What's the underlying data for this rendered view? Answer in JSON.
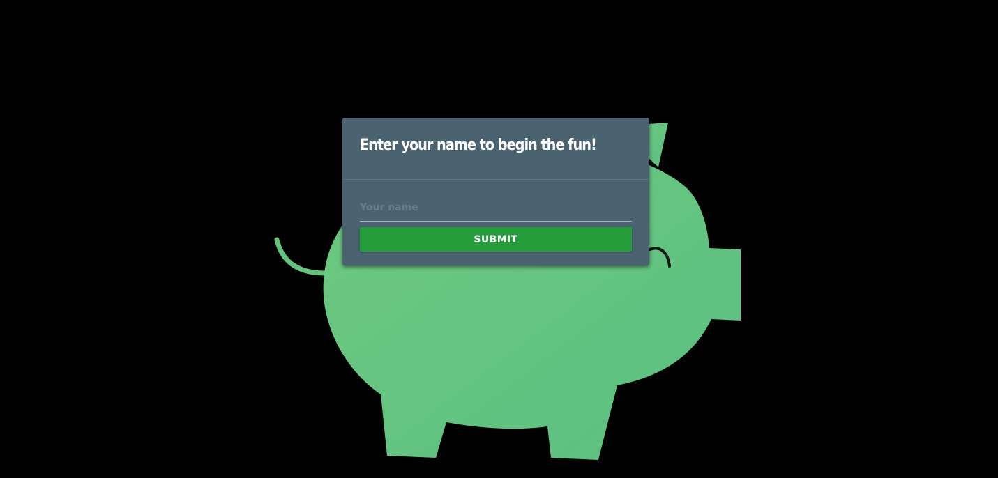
{
  "modal": {
    "title": "Enter your name to begin the fun!",
    "name_placeholder": "Your name",
    "name_value": "",
    "submit_label": "SUBMIT"
  },
  "colors": {
    "background": "#020202",
    "pig": "#65c27c",
    "modal": "#4b6371",
    "button": "#249d3a",
    "text": "#ffffff"
  },
  "background": {
    "illustration": "piggy-bank-illustration"
  }
}
